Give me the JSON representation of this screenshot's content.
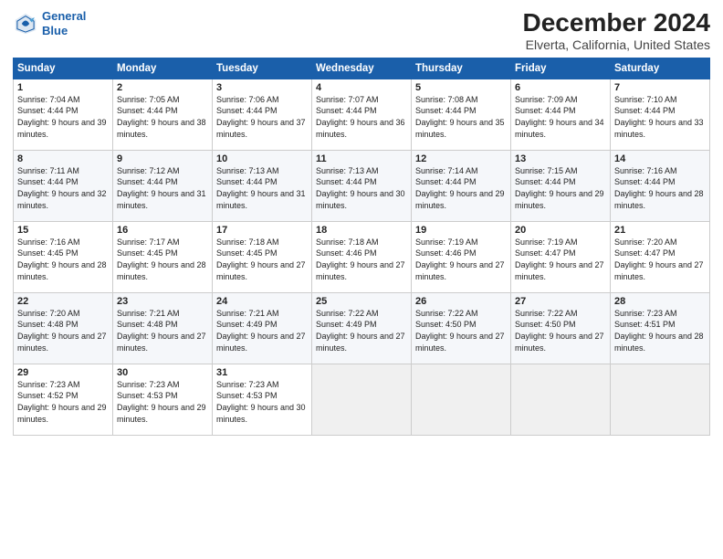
{
  "logo": {
    "line1": "General",
    "line2": "Blue"
  },
  "title": "December 2024",
  "subtitle": "Elverta, California, United States",
  "days_of_week": [
    "Sunday",
    "Monday",
    "Tuesday",
    "Wednesday",
    "Thursday",
    "Friday",
    "Saturday"
  ],
  "weeks": [
    [
      {
        "day": "1",
        "sunrise": "7:04 AM",
        "sunset": "4:44 PM",
        "daylight": "9 hours and 39 minutes."
      },
      {
        "day": "2",
        "sunrise": "7:05 AM",
        "sunset": "4:44 PM",
        "daylight": "9 hours and 38 minutes."
      },
      {
        "day": "3",
        "sunrise": "7:06 AM",
        "sunset": "4:44 PM",
        "daylight": "9 hours and 37 minutes."
      },
      {
        "day": "4",
        "sunrise": "7:07 AM",
        "sunset": "4:44 PM",
        "daylight": "9 hours and 36 minutes."
      },
      {
        "day": "5",
        "sunrise": "7:08 AM",
        "sunset": "4:44 PM",
        "daylight": "9 hours and 35 minutes."
      },
      {
        "day": "6",
        "sunrise": "7:09 AM",
        "sunset": "4:44 PM",
        "daylight": "9 hours and 34 minutes."
      },
      {
        "day": "7",
        "sunrise": "7:10 AM",
        "sunset": "4:44 PM",
        "daylight": "9 hours and 33 minutes."
      }
    ],
    [
      {
        "day": "8",
        "sunrise": "7:11 AM",
        "sunset": "4:44 PM",
        "daylight": "9 hours and 32 minutes."
      },
      {
        "day": "9",
        "sunrise": "7:12 AM",
        "sunset": "4:44 PM",
        "daylight": "9 hours and 31 minutes."
      },
      {
        "day": "10",
        "sunrise": "7:13 AM",
        "sunset": "4:44 PM",
        "daylight": "9 hours and 31 minutes."
      },
      {
        "day": "11",
        "sunrise": "7:13 AM",
        "sunset": "4:44 PM",
        "daylight": "9 hours and 30 minutes."
      },
      {
        "day": "12",
        "sunrise": "7:14 AM",
        "sunset": "4:44 PM",
        "daylight": "9 hours and 29 minutes."
      },
      {
        "day": "13",
        "sunrise": "7:15 AM",
        "sunset": "4:44 PM",
        "daylight": "9 hours and 29 minutes."
      },
      {
        "day": "14",
        "sunrise": "7:16 AM",
        "sunset": "4:44 PM",
        "daylight": "9 hours and 28 minutes."
      }
    ],
    [
      {
        "day": "15",
        "sunrise": "7:16 AM",
        "sunset": "4:45 PM",
        "daylight": "9 hours and 28 minutes."
      },
      {
        "day": "16",
        "sunrise": "7:17 AM",
        "sunset": "4:45 PM",
        "daylight": "9 hours and 28 minutes."
      },
      {
        "day": "17",
        "sunrise": "7:18 AM",
        "sunset": "4:45 PM",
        "daylight": "9 hours and 27 minutes."
      },
      {
        "day": "18",
        "sunrise": "7:18 AM",
        "sunset": "4:46 PM",
        "daylight": "9 hours and 27 minutes."
      },
      {
        "day": "19",
        "sunrise": "7:19 AM",
        "sunset": "4:46 PM",
        "daylight": "9 hours and 27 minutes."
      },
      {
        "day": "20",
        "sunrise": "7:19 AM",
        "sunset": "4:47 PM",
        "daylight": "9 hours and 27 minutes."
      },
      {
        "day": "21",
        "sunrise": "7:20 AM",
        "sunset": "4:47 PM",
        "daylight": "9 hours and 27 minutes."
      }
    ],
    [
      {
        "day": "22",
        "sunrise": "7:20 AM",
        "sunset": "4:48 PM",
        "daylight": "9 hours and 27 minutes."
      },
      {
        "day": "23",
        "sunrise": "7:21 AM",
        "sunset": "4:48 PM",
        "daylight": "9 hours and 27 minutes."
      },
      {
        "day": "24",
        "sunrise": "7:21 AM",
        "sunset": "4:49 PM",
        "daylight": "9 hours and 27 minutes."
      },
      {
        "day": "25",
        "sunrise": "7:22 AM",
        "sunset": "4:49 PM",
        "daylight": "9 hours and 27 minutes."
      },
      {
        "day": "26",
        "sunrise": "7:22 AM",
        "sunset": "4:50 PM",
        "daylight": "9 hours and 27 minutes."
      },
      {
        "day": "27",
        "sunrise": "7:22 AM",
        "sunset": "4:50 PM",
        "daylight": "9 hours and 27 minutes."
      },
      {
        "day": "28",
        "sunrise": "7:23 AM",
        "sunset": "4:51 PM",
        "daylight": "9 hours and 28 minutes."
      }
    ],
    [
      {
        "day": "29",
        "sunrise": "7:23 AM",
        "sunset": "4:52 PM",
        "daylight": "9 hours and 29 minutes."
      },
      {
        "day": "30",
        "sunrise": "7:23 AM",
        "sunset": "4:53 PM",
        "daylight": "9 hours and 29 minutes."
      },
      {
        "day": "31",
        "sunrise": "7:23 AM",
        "sunset": "4:53 PM",
        "daylight": "9 hours and 30 minutes."
      },
      null,
      null,
      null,
      null
    ]
  ]
}
